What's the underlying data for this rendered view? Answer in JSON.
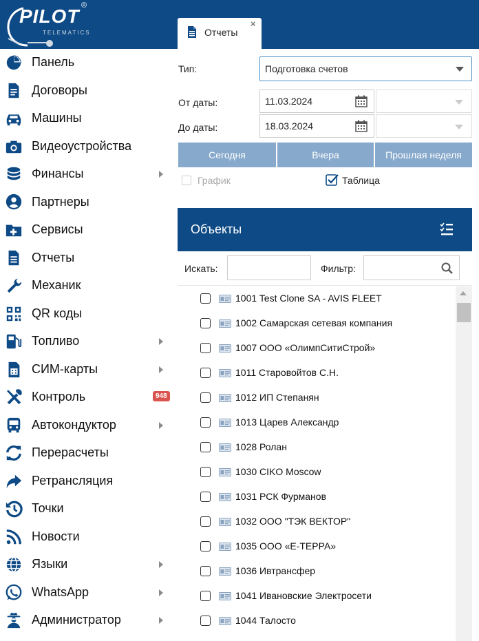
{
  "brand": {
    "name": "PILOT",
    "sub": "TELEMATICS",
    "reg": "®"
  },
  "tab": {
    "label": "Отчеты",
    "close": "×"
  },
  "sidebar": {
    "items": [
      {
        "label": "Панель",
        "icon": "pie-chart-icon",
        "arrow": false
      },
      {
        "label": "Договоры",
        "icon": "document-icon",
        "arrow": false
      },
      {
        "label": "Машины",
        "icon": "car-icon",
        "arrow": false
      },
      {
        "label": "Видеоустройства",
        "icon": "camera-icon",
        "arrow": false
      },
      {
        "label": "Финансы",
        "icon": "coins-icon",
        "arrow": true
      },
      {
        "label": "Партнеры",
        "icon": "user-circle-icon",
        "arrow": false
      },
      {
        "label": "Сервисы",
        "icon": "folder-plus-icon",
        "arrow": false
      },
      {
        "label": "Отчеты",
        "icon": "file-text-icon",
        "arrow": false
      },
      {
        "label": "Механик",
        "icon": "wrench-icon",
        "arrow": false
      },
      {
        "label": "QR коды",
        "icon": "qrcode-icon",
        "arrow": false
      },
      {
        "label": "Топливо",
        "icon": "fuel-pump-icon",
        "arrow": true
      },
      {
        "label": "СИМ-карты",
        "icon": "sim-card-icon",
        "arrow": true
      },
      {
        "label": "Контроль",
        "icon": "tools-icon",
        "arrow": false,
        "badge": "948"
      },
      {
        "label": "Автокондуктор",
        "icon": "bus-icon",
        "arrow": true
      },
      {
        "label": "Перерасчеты",
        "icon": "refresh-icon",
        "arrow": false
      },
      {
        "label": "Ретрансляция",
        "icon": "share-arrow-icon",
        "arrow": false
      },
      {
        "label": "Точки",
        "icon": "history-icon",
        "arrow": false
      },
      {
        "label": "Новости",
        "icon": "rss-icon",
        "arrow": false
      },
      {
        "label": "Языки",
        "icon": "globe-icon",
        "arrow": true
      },
      {
        "label": "WhatsApp",
        "icon": "whatsapp-icon",
        "arrow": true
      },
      {
        "label": "Администратор",
        "icon": "user-secret-icon",
        "arrow": true
      }
    ]
  },
  "form": {
    "type_label": "Тип:",
    "type_value": "Подготовка счетов",
    "from_label": "От даты:",
    "from_value": "11.03.2024",
    "to_label": "До даты:",
    "to_value": "18.03.2024",
    "btn_today": "Сегодня",
    "btn_yesterday": "Вчера",
    "btn_last_week": "Прошлая неделя",
    "chart_label": "График",
    "chart_checked": false,
    "table_label": "Таблица",
    "table_checked": true
  },
  "objects": {
    "title": "Объекты",
    "search_label": "Искать:",
    "filter_label": "Фильтр:",
    "items": [
      "1001 Test Clone SA - AVIS FLEET",
      "1002 Самарская сетевая компания",
      "1007 ООО «ОлимпСитиСтрой»",
      "1011 Старовойтов С.Н.",
      "1012 ИП Степанян",
      "1013 Царев Александр",
      "1028 Ролан",
      "1030 CIKO Moscow",
      "1031 РСК Фурманов",
      "1032 ООО \"ТЭК ВЕКТОР\"",
      "1035 ООО «Е-ТЕРРА»",
      "1036 Ивтрансфер",
      "1041 Ивановские Электросети",
      "1044 Талосто"
    ]
  },
  "colors": {
    "primary": "#0e4a85",
    "button": "#87a9cc",
    "badge": "#d9534f"
  }
}
